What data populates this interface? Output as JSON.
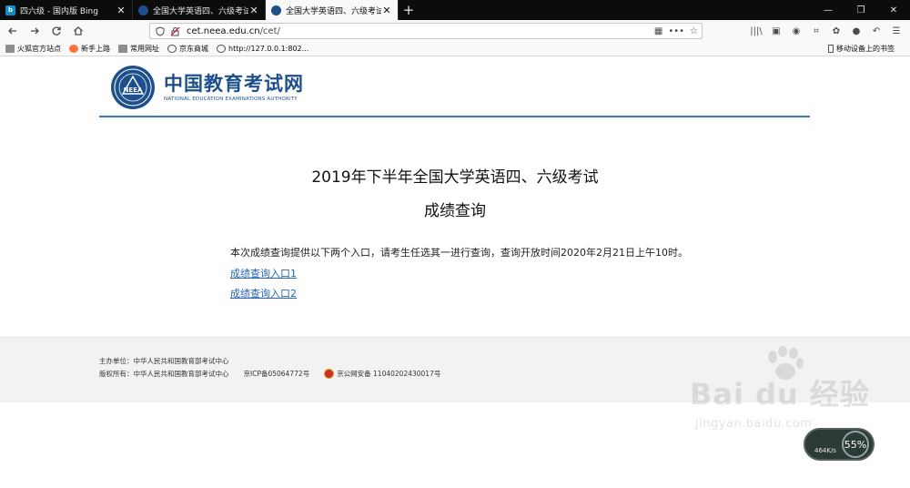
{
  "browser": {
    "tabs": [
      {
        "title": "四六级 - 国内版 Bing",
        "favicon": "bing-icon",
        "active": false
      },
      {
        "title": "全国大学英语四、六级考试(CET)",
        "favicon": "neea-icon",
        "active": false
      },
      {
        "title": "全国大学英语四、六级考试成绩",
        "favicon": "neea-icon",
        "active": true
      }
    ],
    "url_host": "cet.neea.edu.cn",
    "url_path": "/cet/",
    "bookmarks": [
      "火狐官方站点",
      "新手上路",
      "常用网址",
      "京东商城",
      "http://127.0.0.1:802..."
    ],
    "mobile_bookmarks": "移动设备上的书签"
  },
  "site": {
    "logo_cn": "中国教育考试网",
    "logo_en": "NATIONAL EDUCATION EXAMINATIONS AUTHORITY",
    "logo_seal_text": "NEEA",
    "brand_color": "#1d4f8c",
    "rule_color": "#3b79b6"
  },
  "main": {
    "title_line1": "2019年下半年全国大学英语四、六级考试",
    "title_line2": "成绩查询",
    "notice": "本次成绩查询提供以下两个入口，请考生任选其一进行查询，查询开放时间2020年2月21日上午10时。",
    "link1": "成绩查询入口1",
    "link2": "成绩查询入口2",
    "link_color": "#2a63b4"
  },
  "footer": {
    "sponsor": "主办单位：中华人民共和国教育部考试中心",
    "copyright": "版权所有：中华人民共和国教育部考试中心",
    "icp": "京ICP备05064772号",
    "police": "京公网安备 11040202430017号"
  },
  "overlay": {
    "watermark_brand": "Bai du 经验",
    "watermark_url": "jingyan.baidu.com",
    "speed_percent": "55%",
    "speed_rate": "464K/s"
  }
}
